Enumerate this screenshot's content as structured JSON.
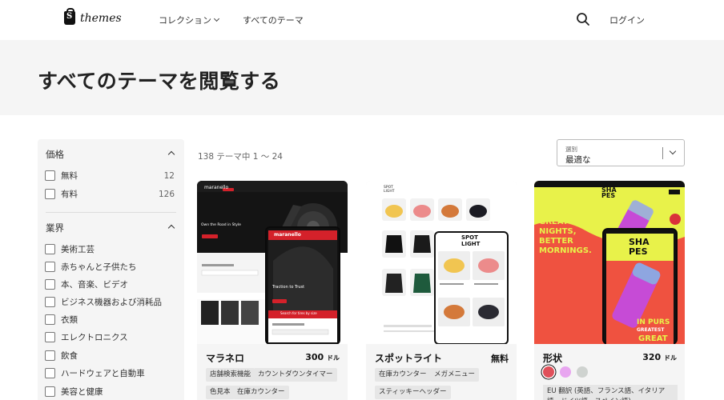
{
  "header": {
    "logo_text": "themes",
    "nav": [
      {
        "label": "コレクション"
      },
      {
        "label": "すべてのテーマ"
      }
    ],
    "login_label": "ログイン"
  },
  "hero": {
    "title": "すべてのテーマを閲覧する"
  },
  "sidebar": {
    "price": {
      "title": "価格",
      "options": [
        {
          "label": "無料",
          "count": "12"
        },
        {
          "label": "有料",
          "count": "126"
        }
      ]
    },
    "industry": {
      "title": "業界",
      "options": [
        {
          "label": "美術工芸"
        },
        {
          "label": "赤ちゃんと子供たち"
        },
        {
          "label": "本、音楽、ビデオ"
        },
        {
          "label": "ビジネス機器および消耗品"
        },
        {
          "label": "衣類"
        },
        {
          "label": "エレクトロニクス"
        },
        {
          "label": "飲食"
        },
        {
          "label": "ハードウェアと自動車"
        },
        {
          "label": "美容と健康"
        }
      ]
    }
  },
  "results": {
    "count_text": "138 テーマ中 1 〜 24",
    "sort_label": "選別",
    "sort_value": "最適な"
  },
  "cards": [
    {
      "title": "マラネロ",
      "price": "300",
      "unit": "ドル",
      "tags": [
        "店舗検索機能",
        "カウントダウンタイマー",
        "色見本",
        "在庫カウンター"
      ],
      "preview": {
        "brand": "maranello",
        "headline": "Own the Road in Style",
        "mobile_headline": "Traction to Trust",
        "banner": "Search for tires by size"
      }
    },
    {
      "title": "スポットライト",
      "price": "無料",
      "tags": [
        "在庫カウンター",
        "メガメニュー",
        "スティッキーヘッダー"
      ],
      "preview": {
        "brand_top": "SPOT",
        "brand_bottom": "LIGHT"
      }
    },
    {
      "title": "形状",
      "price": "320",
      "unit": "ドル",
      "swatches": [
        "#e0505a",
        "#e8a6f0",
        "#cfd3d0"
      ],
      "languages": "EU 翻訳 (英語、フランス語、イタリア語、ドイツ語、スペイン語)",
      "preview": {
        "brand_top": "SHA",
        "brand_bottom": "PES",
        "headline_1": "GREAT",
        "headline_2": "NIGHTS,",
        "headline_3": "BETTER",
        "headline_4": "MORNINGS.",
        "mobile_text": "IN PURS",
        "mobile_text_2": "GREATEST",
        "mobile_text_3": "GREAT"
      }
    }
  ],
  "colors": {
    "hero_bg": "#f5f5f5",
    "maranello_red": "#d4212a",
    "shapes_yellow": "#e8f24a",
    "shapes_red": "#e8423a"
  }
}
